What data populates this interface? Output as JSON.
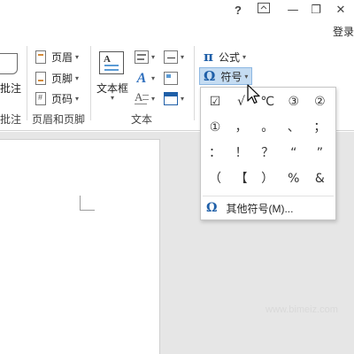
{
  "titlebar": {
    "help_label": "?",
    "ribbon_options_icon": "ribbon-display-options-icon",
    "minimize_label": "—",
    "restore_label": "❐",
    "close_label": "✕",
    "login_label": "登录"
  },
  "ribbon": {
    "comment_label": "批注",
    "comment_group_label": "批注",
    "header_label": "页眉",
    "footer_label": "页脚",
    "page_number_label": "页码",
    "header_footer_group_label": "页眉和页脚",
    "textbox_label": "文本框",
    "text_group_label": "文本",
    "equation_glyph": "π",
    "equation_label": "公式",
    "symbol_glyph": "Ω",
    "symbol_label": "符号",
    "dropdown_arrow": "▾"
  },
  "symbol_menu": {
    "symbols": [
      "☑",
      "√",
      "℃",
      "③",
      "②",
      "①",
      "，",
      "。",
      "、",
      "；",
      "：",
      "！",
      "？",
      "“",
      "”",
      "（",
      "【",
      "）",
      "%",
      "&"
    ],
    "more_glyph": "Ω",
    "more_label": "其他符号(M)..."
  },
  "watermark": "www.bimeiz.com",
  "colors": {
    "accent_blue": "#1f5fa8",
    "active_button_bg": "#c5dcf2",
    "document_bg": "#e6e6e6"
  }
}
